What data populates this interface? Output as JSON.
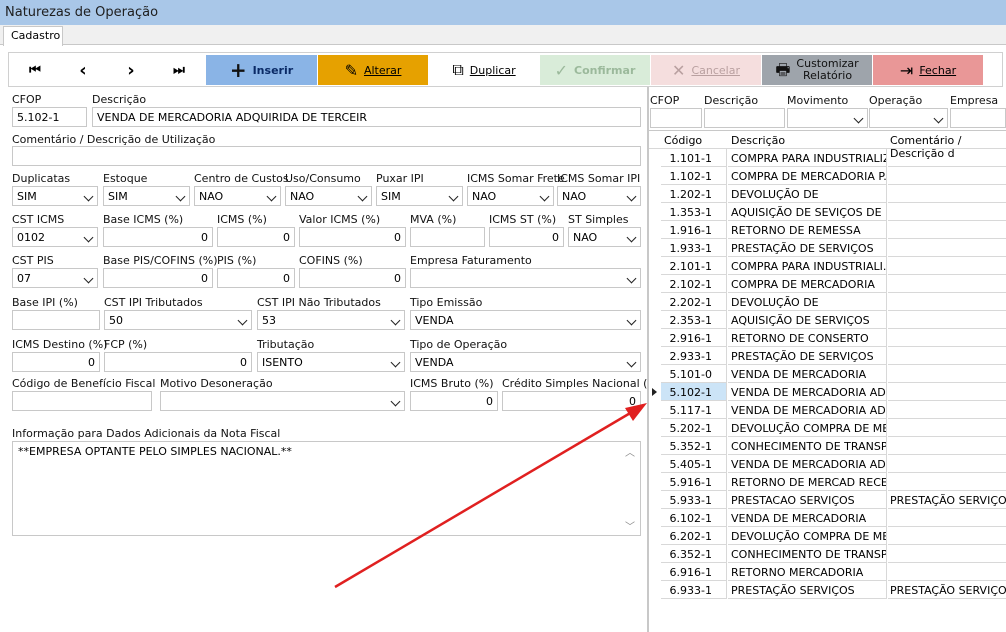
{
  "window": {
    "title": "Naturezas de Operação"
  },
  "tabs": [
    {
      "label": "Cadastro"
    }
  ],
  "toolbar": {
    "first": "⏮",
    "prev": "‹",
    "next": "›",
    "last": "⏭",
    "inserir": "Inserir",
    "alterar": "Alterar",
    "duplicar": "Duplicar",
    "confirmar": "Confirmar",
    "cancelar": "Cancelar",
    "relatorio_line1": "Customizar",
    "relatorio_line2": "Relatório",
    "fechar": "Fechar"
  },
  "form": {
    "cfop_label": "CFOP",
    "cfop_value": "5.102-1",
    "descricao_label": "Descrição",
    "descricao_value": "VENDA DE MERCADORIA ADQUIRIDA DE TERCEIR",
    "comentario_label": "Comentário / Descrição de Utilização",
    "comentario_value": "",
    "duplicatas_label": "Duplicatas",
    "duplicatas_value": "SIM",
    "estoque_label": "Estoque",
    "estoque_value": "SIM",
    "centro_label": "Centro de Custos",
    "centro_value": "NAO",
    "uso_label": "Uso/Consumo",
    "uso_value": "NAO",
    "puxar_label": "Puxar IPI",
    "puxar_value": "SIM",
    "icms_frete_label": "ICMS Somar Frete",
    "icms_frete_value": "NAO",
    "icms_ipi_label": "ICMS Somar IPI",
    "icms_ipi_value": "NAO",
    "cst_icms_label": "CST ICMS",
    "cst_icms_value": "0102",
    "base_icms_label": "Base ICMS (%)",
    "base_icms_value": "0",
    "icms_label": "ICMS (%)",
    "icms_value": "0",
    "valor_icms_label": "Valor ICMS (%)",
    "valor_icms_value": "0",
    "mva_label": "MVA (%)",
    "mva_value": "",
    "icms_st_label": "ICMS ST (%)",
    "icms_st_value": "0",
    "st_simples_label": "ST Simples",
    "st_simples_value": "NAO",
    "cst_pis_label": "CST PIS",
    "cst_pis_value": "07",
    "base_pis_label": "Base PIS/COFINS (%)",
    "base_pis_value": "0",
    "pis_label": "PIS (%)",
    "pis_value": "0",
    "cofins_label": "COFINS (%)",
    "cofins_value": "0",
    "empresa_label": "Empresa Faturamento",
    "empresa_value": "",
    "base_ipi_label": "Base IPI (%)",
    "base_ipi_value": "",
    "cst_ipi_trib_label": "CST IPI Tributados",
    "cst_ipi_trib_value": "50",
    "cst_ipi_nao_label": "CST IPI Não Tributados",
    "cst_ipi_nao_value": "53",
    "tipo_emissao_label": "Tipo Emissão",
    "tipo_emissao_value": "VENDA",
    "icms_destino_label": "ICMS Destino (%)",
    "icms_destino_value": "0",
    "fcp_label": "FCP (%)",
    "fcp_value": "0",
    "tributacao_label": "Tributação",
    "tributacao_value": "ISENTO",
    "tipo_op_label": "Tipo de Operação",
    "tipo_op_value": "VENDA",
    "cod_beneficio_label": "Código de Benefício Fiscal",
    "cod_beneficio_value": "",
    "motivo_label": "Motivo Desoneração",
    "motivo_value": "",
    "icms_bruto_label": "ICMS Bruto (%)",
    "icms_bruto_value": "0",
    "credito_label": "Crédito Simples Nacional (%)",
    "credito_value": "0",
    "info_label": "Informação para Dados Adicionais da Nota Fiscal",
    "info_value": "**EMPRESA OPTANTE PELO SIMPLES NACIONAL.**"
  },
  "filter": {
    "cfop": "CFOP",
    "descricao": "Descrição",
    "movimento": "Movimento",
    "operacao": "Operação",
    "empresa": "Empresa"
  },
  "grid": {
    "headers": [
      "Código",
      "Descrição",
      "Comentário / Descrição d"
    ],
    "rows": [
      {
        "codigo": "1.101-1",
        "descricao": "COMPRA PARA INDUSTRIALIZ...",
        "comentario": ""
      },
      {
        "codigo": "1.102-1",
        "descricao": "COMPRA DE MERCADORIA P...",
        "comentario": ""
      },
      {
        "codigo": "1.202-1",
        "descricao": "DEVOLUÇÃO DE",
        "comentario": ""
      },
      {
        "codigo": "1.353-1",
        "descricao": "AQUISIÇÃO DE SEVIÇOS DE ...",
        "comentario": ""
      },
      {
        "codigo": "1.916-1",
        "descricao": "RETORNO DE REMESSA",
        "comentario": ""
      },
      {
        "codigo": "1.933-1",
        "descricao": "PRESTAÇÃO DE SERVIÇOS",
        "comentario": ""
      },
      {
        "codigo": "2.101-1",
        "descricao": "COMPRA PARA INDUSTRIALI...",
        "comentario": ""
      },
      {
        "codigo": "2.102-1",
        "descricao": "COMPRA DE MERCADORIA",
        "comentario": ""
      },
      {
        "codigo": "2.202-1",
        "descricao": "DEVOLUÇÃO DE",
        "comentario": ""
      },
      {
        "codigo": "2.353-1",
        "descricao": "AQUISIÇÃO DE SERVIÇOS",
        "comentario": ""
      },
      {
        "codigo": "2.916-1",
        "descricao": "RETORNO DE CONSERTO",
        "comentario": ""
      },
      {
        "codigo": "2.933-1",
        "descricao": "PRESTAÇÃO DE SERVIÇOS",
        "comentario": ""
      },
      {
        "codigo": "5.101-0",
        "descricao": "VENDA DE MERCADORIA",
        "comentario": ""
      },
      {
        "codigo": "5.102-1",
        "descricao": "VENDA DE MERCADORIA AD...",
        "comentario": ""
      },
      {
        "codigo": "5.117-1",
        "descricao": "VENDA DE MERCADORIA AD...",
        "comentario": ""
      },
      {
        "codigo": "5.202-1",
        "descricao": "DEVOLUÇÃO COMPRA DE ME...",
        "comentario": ""
      },
      {
        "codigo": "5.352-1",
        "descricao": "CONHECIMENTO DE TRANSP...",
        "comentario": ""
      },
      {
        "codigo": "5.405-1",
        "descricao": "VENDA DE MERCADORIA AD...",
        "comentario": ""
      },
      {
        "codigo": "5.916-1",
        "descricao": "RETORNO DE MERCAD RECE...",
        "comentario": ""
      },
      {
        "codigo": "5.933-1",
        "descricao": "PRESTACAO SERVIÇOS",
        "comentario": "PRESTAÇÃO SERVIÇOS"
      },
      {
        "codigo": "6.102-1",
        "descricao": "VENDA DE MERCADORIA",
        "comentario": ""
      },
      {
        "codigo": "6.202-1",
        "descricao": "DEVOLUÇÃO COMPRA DE ME...",
        "comentario": ""
      },
      {
        "codigo": "6.352-1",
        "descricao": "CONHECIMENTO DE TRANSP...",
        "comentario": ""
      },
      {
        "codigo": "6.916-1",
        "descricao": "RETORNO MERCADORIA",
        "comentario": ""
      },
      {
        "codigo": "6.933-1",
        "descricao": "PRESTAÇÃO SERVIÇOS",
        "comentario": "PRESTAÇÃO SERVIÇOS"
      }
    ],
    "selected_index": 13
  },
  "colors": {
    "titlebar": "#a9c7e8",
    "annotation_arrow": "#e02020",
    "selection": "#cce4f7"
  }
}
